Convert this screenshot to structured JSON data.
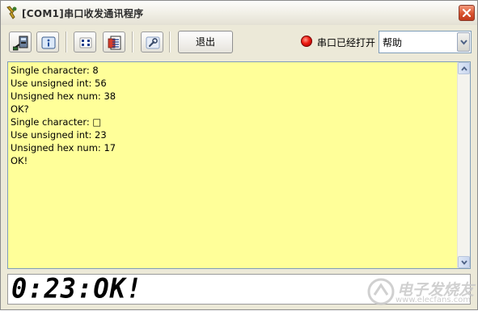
{
  "window": {
    "title": "[COM1]串口收发通讯程序",
    "close_icon": "close-x-icon"
  },
  "toolbar": {
    "buttons": [
      {
        "name": "connect-button",
        "icon": "serial-port-icon"
      },
      {
        "name": "info-button",
        "icon": "info-icon"
      },
      {
        "name": "settings-button",
        "icon": "dip-switch-icon"
      },
      {
        "name": "document-button",
        "icon": "document-icon"
      },
      {
        "name": "tools-button",
        "icon": "wrench-icon"
      }
    ],
    "exit_label": "退出",
    "status_led_color": "#ee1a10",
    "status_text": "串口已经打开",
    "help_select_value": "帮助"
  },
  "output": {
    "background": "#ffff99",
    "lines": [
      "Single character: 8",
      "Use unsigned int: 56",
      "Unsigned hex num: 38",
      "OK?",
      "Single character: □",
      "Use unsigned int: 23",
      "Unsigned hex num: 17",
      "OK!"
    ]
  },
  "lcd": {
    "text": "0:23:OK!"
  },
  "watermark": {
    "main": "电子发烧友",
    "url": "www.elecfans.com"
  }
}
